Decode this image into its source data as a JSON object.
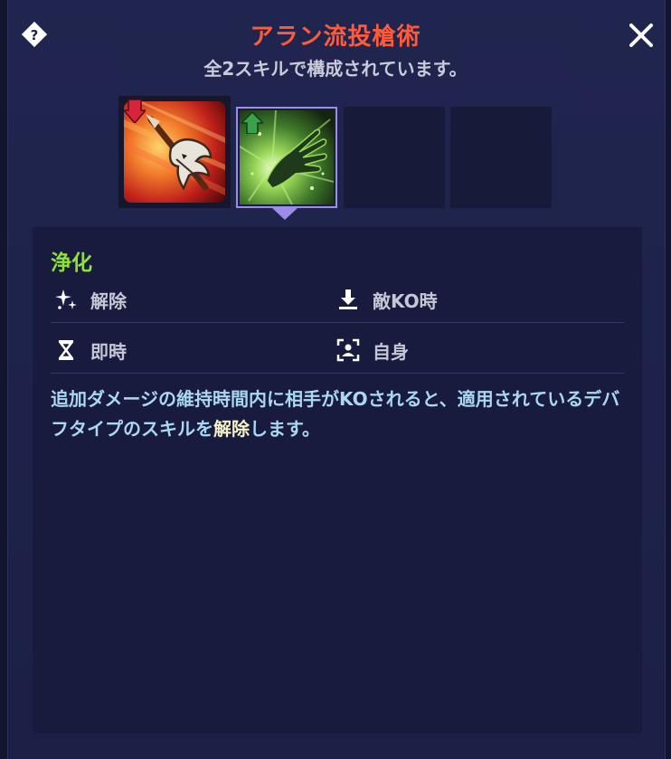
{
  "header": {
    "title": "アラン流投槍術",
    "subtitle": "全2スキルで構成されています。"
  },
  "skill": {
    "name": "浄化",
    "attributes": [
      {
        "label": "解除",
        "icon": "sparkle-icon"
      },
      {
        "label": "敵KO時",
        "icon": "download-icon"
      },
      {
        "label": "即時",
        "icon": "hourglass-icon"
      },
      {
        "label": "自身",
        "icon": "self-target-icon"
      }
    ],
    "description_before": "追加ダメージの維持時間内に相手がKOされると、適用されているデバフタイプのスキルを",
    "description_highlight": "解除",
    "description_after": "します。"
  },
  "slots": [
    {
      "icon": "spear-dragon-skill-icon",
      "badge": "debuff-arrow-down"
    },
    {
      "icon": "glowing-hand-skill-icon",
      "badge": "buff-arrow-up",
      "selected": true
    },
    {
      "icon": "empty-slot"
    },
    {
      "icon": "empty-slot"
    }
  ],
  "colors": {
    "title": "#ff5a3a",
    "skill_name": "#8fe03a",
    "description": "#a9d7f4",
    "highlight": "#f5f0c8",
    "selection_border": "#9a8ee8"
  }
}
